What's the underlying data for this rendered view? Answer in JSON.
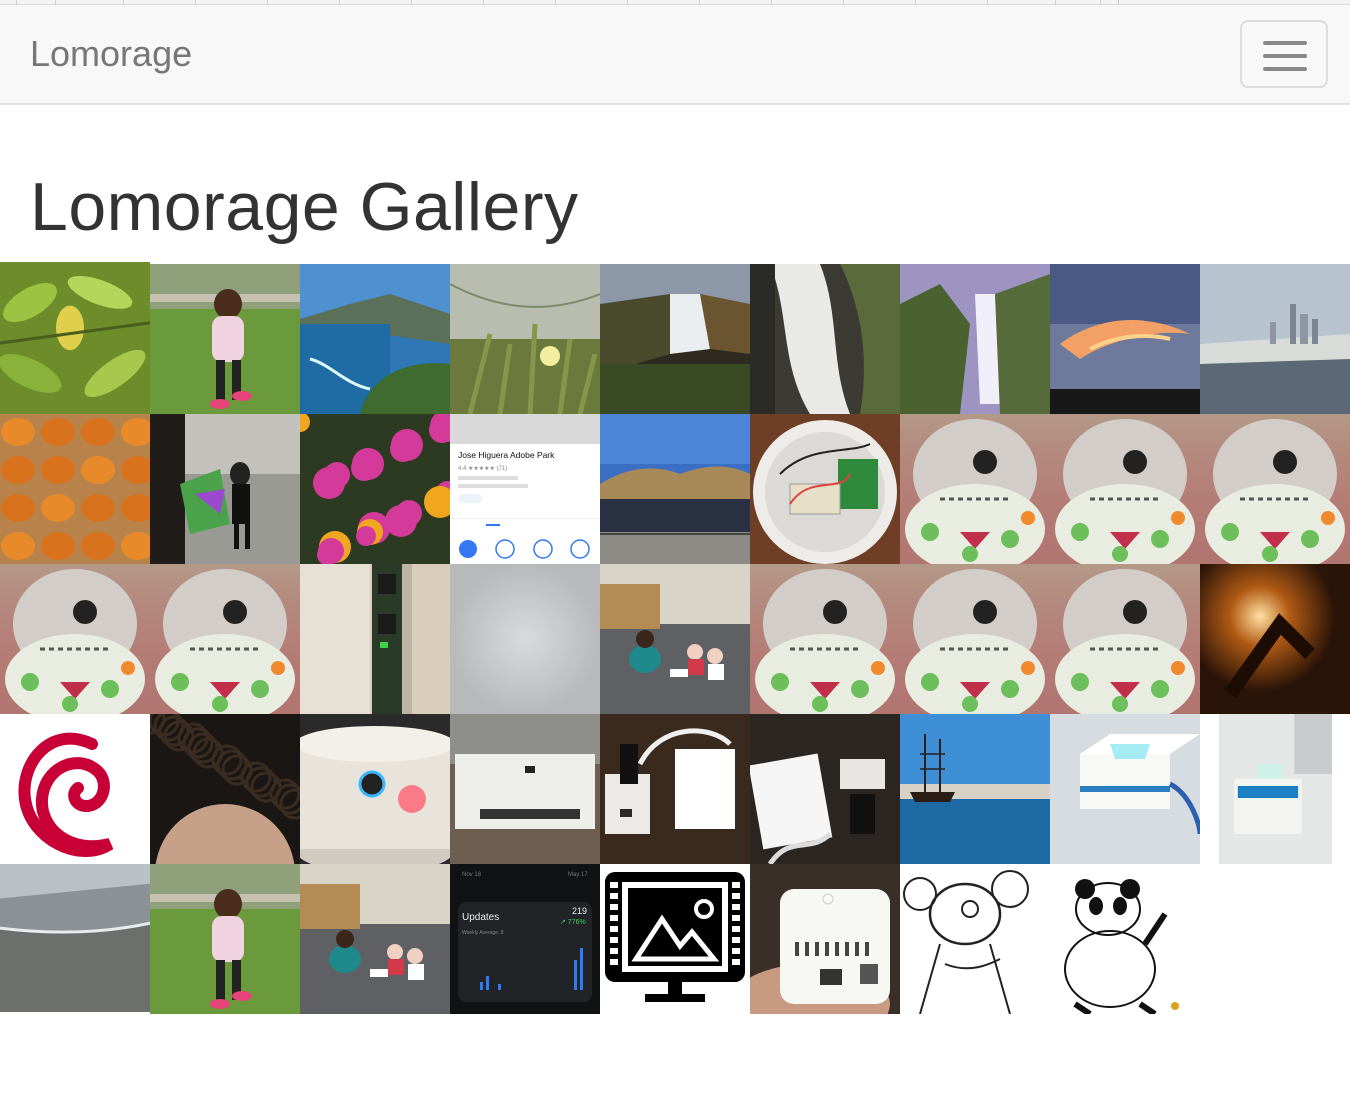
{
  "navbar": {
    "brand": "Lomorage"
  },
  "page": {
    "title": "Lomorage Gallery"
  },
  "gallery": {
    "items": [
      {
        "id": "leaves",
        "row": 0,
        "col": 0
      },
      {
        "id": "girl-walking-grass",
        "row": 0,
        "col": 1
      },
      {
        "id": "coast-cliffs",
        "row": 0,
        "col": 2
      },
      {
        "id": "grass-flower",
        "row": 0,
        "col": 3
      },
      {
        "id": "waterfall-canyon",
        "row": 0,
        "col": 4
      },
      {
        "id": "waterfall-closeup",
        "row": 0,
        "col": 5
      },
      {
        "id": "waterfall-purple-sky",
        "row": 0,
        "col": 6
      },
      {
        "id": "sunset-cloud",
        "row": 0,
        "col": 7
      },
      {
        "id": "city-skyline-bay",
        "row": 0,
        "col": 8
      },
      {
        "id": "pumpkins",
        "row": 1,
        "col": 0
      },
      {
        "id": "kids-hallway",
        "row": 1,
        "col": 1
      },
      {
        "id": "pink-flowers",
        "row": 1,
        "col": 2
      },
      {
        "id": "maps-screenshot",
        "row": 1,
        "col": 3
      },
      {
        "id": "crowd-hills",
        "row": 1,
        "col": 4
      },
      {
        "id": "raspberry-pi-enclosure",
        "row": 1,
        "col": 5
      },
      {
        "id": "plush-child",
        "row": 1,
        "col": 6
      },
      {
        "id": "plush-child",
        "row": 1,
        "col": 7
      },
      {
        "id": "plush-child",
        "row": 1,
        "col": 8
      },
      {
        "id": "plush-child",
        "row": 2,
        "col": 0
      },
      {
        "id": "plush-child",
        "row": 2,
        "col": 1
      },
      {
        "id": "circuit-board-side",
        "row": 2,
        "col": 2
      },
      {
        "id": "blurred-gray",
        "row": 2,
        "col": 3
      },
      {
        "id": "classroom-kids",
        "row": 2,
        "col": 4
      },
      {
        "id": "plush-child",
        "row": 2,
        "col": 5
      },
      {
        "id": "plush-child",
        "row": 2,
        "col": 6
      },
      {
        "id": "plush-child",
        "row": 2,
        "col": 7
      },
      {
        "id": "blurred-fire",
        "row": 2,
        "col": 8
      },
      {
        "id": "debian-logo",
        "row": 3,
        "col": 0
      },
      {
        "id": "child-hair",
        "row": 3,
        "col": 1
      },
      {
        "id": "white-button-device",
        "row": 3,
        "col": 2
      },
      {
        "id": "white-box-device",
        "row": 3,
        "col": 3
      },
      {
        "id": "usb-hub-cables",
        "row": 3,
        "col": 4
      },
      {
        "id": "wifi-box-cables",
        "row": 3,
        "col": 5
      },
      {
        "id": "harbor-ship",
        "row": 3,
        "col": 6
      },
      {
        "id": "device-blue-led",
        "row": 3,
        "col": 7
      },
      {
        "id": "device-blue-led-far",
        "row": 3,
        "col": 8
      },
      {
        "id": "beach-shoreline",
        "row": 4,
        "col": 0
      },
      {
        "id": "girl-walking-grass",
        "row": 4,
        "col": 1
      },
      {
        "id": "classroom-kids",
        "row": 4,
        "col": 2
      },
      {
        "id": "updates-screenshot",
        "row": 4,
        "col": 3
      },
      {
        "id": "gallery-icon",
        "row": 4,
        "col": 4
      },
      {
        "id": "white-cube-hand",
        "row": 4,
        "col": 5
      },
      {
        "id": "cartoon-mouse-sketch",
        "row": 4,
        "col": 6
      },
      {
        "id": "cartoon-panda-sketch",
        "row": 4,
        "col": 7
      }
    ]
  },
  "thumb_text": {
    "maps_place": "Jose Higuera Adobe Park",
    "maps_rating": "4.4 ★★★★★ (71)",
    "updates_label": "Updates",
    "updates_value": "219",
    "updates_change": "↗ 776%",
    "updates_sub": "Weekly Average: 8",
    "updates_from": "Nov 18",
    "updates_to": "May 17"
  }
}
